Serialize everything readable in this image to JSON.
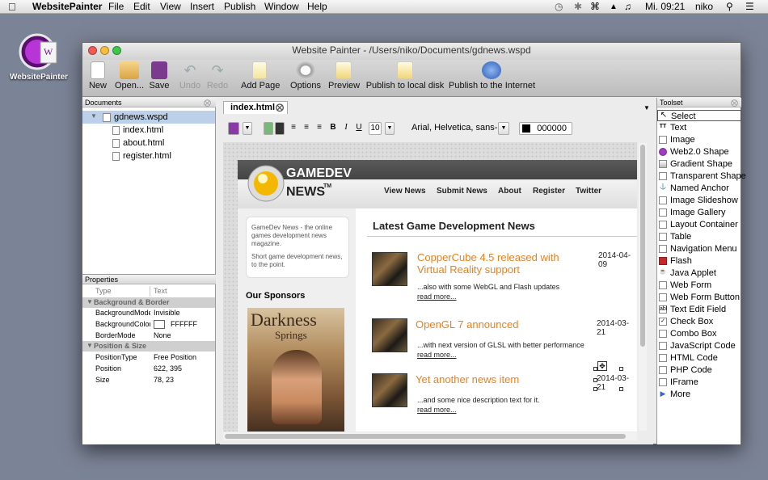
{
  "menubar": {
    "app_name": "WebsitePainter",
    "items": [
      "File",
      "Edit",
      "View",
      "Insert",
      "Publish",
      "Window",
      "Help"
    ],
    "clock": "Mi. 09:21",
    "user": "niko"
  },
  "desktop_icon": {
    "label": "WebsitePainter"
  },
  "window": {
    "title": "Website Painter - /Users/niko/Documents/gdnews.wspd"
  },
  "toolbar": {
    "new": "New",
    "open": "Open...",
    "save": "Save",
    "undo": "Undo",
    "redo": "Redo",
    "add_page": "Add Page",
    "options": "Options",
    "preview": "Preview",
    "publish_local": "Publish to local disk",
    "publish_internet": "Publish to the Internet"
  },
  "documents": {
    "header": "Documents",
    "project": "gdnews.wspd",
    "files": [
      "index.html",
      "about.html",
      "register.html"
    ]
  },
  "properties": {
    "header": "Properties",
    "col_type": "Type",
    "col_value": "Text",
    "section_bg": "Background & Border",
    "bg_mode_key": "BackgroundMode",
    "bg_mode_val": "Invisible",
    "bg_color_key": "BackgroundColor",
    "bg_color_val": "FFFFFF",
    "border_key": "BorderMode",
    "border_val": "None",
    "section_pos": "Position & Size",
    "pos_type_key": "PositionType",
    "pos_type_val": "Free Position",
    "position_key": "Position",
    "position_val": "622, 395",
    "size_key": "Size",
    "size_val": "78, 23"
  },
  "editor": {
    "tab": "index.html",
    "font_size": "10",
    "font_family": "Arial, Helvetica, sans-",
    "color_value": "000000"
  },
  "site": {
    "logo_line1": "GAMEDEV",
    "logo_line2": "NEWS",
    "logo_tm": "TM",
    "nav": [
      "View News",
      "Submit News",
      "About",
      "Register",
      "Twitter"
    ],
    "intro1": "GameDev News - the online games development news magazine.",
    "intro2": "Short game development news, to the point.",
    "sponsors": "Our Sponsors",
    "sponsor_title1": "Darkness",
    "sponsor_title2": "Springs",
    "main_heading": "Latest Game Development News",
    "news": [
      {
        "title": "CopperCube 4.5 released with Virtual Reality support",
        "date": "2014-04-09",
        "desc": "...also with some WebGL and Flash updates",
        "more": "read more..."
      },
      {
        "title": "OpenGL 7 announced",
        "date": "2014-03-21",
        "desc": "...with next version of GLSL with better performance",
        "more": "read more..."
      },
      {
        "title": "Yet another news item",
        "date": "2014-03-21",
        "desc": "...and some nice description text for it.",
        "more": "read more..."
      }
    ]
  },
  "toolset": {
    "header": "Toolset",
    "items": [
      "Select",
      "Text",
      "Image",
      "Web2.0 Shape",
      "Gradient Shape",
      "Transparent Shape",
      "Named Anchor",
      "Image Slideshow",
      "Image Gallery",
      "Layout Container",
      "Table",
      "Navigation Menu",
      "Flash",
      "Java Applet",
      "Web Form",
      "Web Form Button",
      "Text Edit Field",
      "Check Box",
      "Combo Box",
      "JavaScript Code",
      "HTML Code",
      "PHP Code",
      "IFrame",
      "More"
    ]
  },
  "colors": {
    "accent_orange": "#e8821e",
    "selection_blue": "#bcd0ea"
  }
}
